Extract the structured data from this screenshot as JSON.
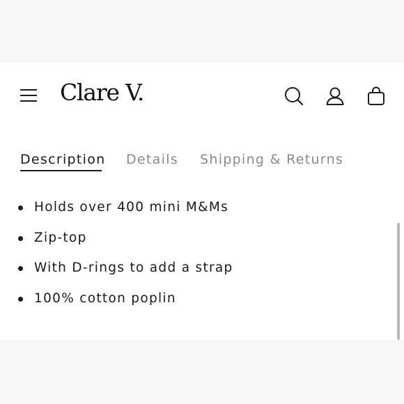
{
  "brand": {
    "logo_text": "Clare V."
  },
  "header": {
    "icons": [
      "hamburger-menu-icon",
      "search-icon",
      "account-icon",
      "shopping-bag-icon"
    ]
  },
  "tabs": [
    {
      "label": "Description",
      "active": true
    },
    {
      "label": "Details",
      "active": false
    },
    {
      "label": "Shipping & Returns",
      "active": false
    }
  ],
  "description": {
    "bullets": [
      "Holds over 400 mini M&Ms",
      "Zip-top",
      "With D-rings to add a strap",
      "100% cotton poplin"
    ]
  },
  "colors": {
    "text": "#1a1a1a",
    "inactive_tab": "#8a8a8a",
    "background": "#ffffff",
    "outer_background": "#f7f7f7"
  }
}
